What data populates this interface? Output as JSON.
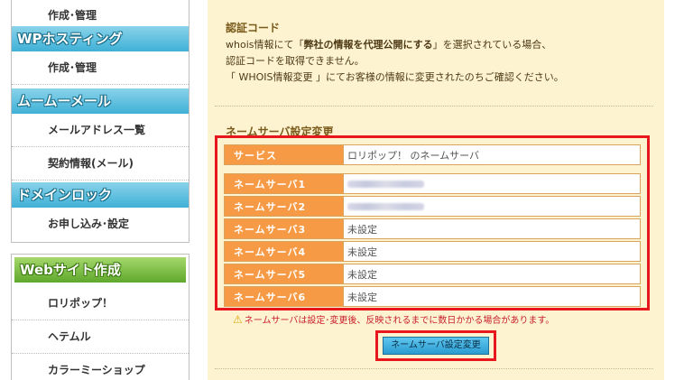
{
  "sidebar": {
    "top_item": "作成･管理",
    "wp_header": "WPホスティング",
    "wp_item": "作成･管理",
    "mumu_header": "ムームーメール",
    "mail_items": [
      "メールアドレス一覧",
      "契約情報(メール)"
    ],
    "domain_lock_header": "ドメインロック",
    "domain_lock_item": "お申し込み･設定",
    "web_header": "Webサイト作成",
    "web_items": [
      "ロリポップ！",
      "ヘテムル",
      "カラーミーショップ"
    ]
  },
  "auth": {
    "title": "認証コード",
    "line1_pre": "whois情報にて「",
    "line1_bold": "弊社の情報を代理公開にする",
    "line1_post": "」を選択されている場合、",
    "line2": "認証コードを取得できません。",
    "line3": "「 WHOIS情報変更 」にてお客様の情報に変更されたのちご確認ください。"
  },
  "ns_section": {
    "title": "ネームサーバ設定変更",
    "service_label": "サービス",
    "service_value": "ロリポップ！ のネームサーバ",
    "rows": [
      {
        "label": "ネームサーバ1",
        "value": ""
      },
      {
        "label": "ネームサーバ2",
        "value": ""
      },
      {
        "label": "ネームサーバ3",
        "value": "未設定"
      },
      {
        "label": "ネームサーバ4",
        "value": "未設定"
      },
      {
        "label": "ネームサーバ5",
        "value": "未設定"
      },
      {
        "label": "ネームサーバ6",
        "value": "未設定"
      }
    ],
    "warning": "ネームサーバは設定･変更後、反映されるまでに数日かかる場合があります。",
    "submit_label": "ネームサーバ設定変更"
  },
  "colors": {
    "label_bg": "#f79a45",
    "highlight": "#e8161d",
    "panel_bg": "#fdf3d1",
    "header_blue": "#3fb0d6",
    "header_green": "#5fa82c"
  }
}
